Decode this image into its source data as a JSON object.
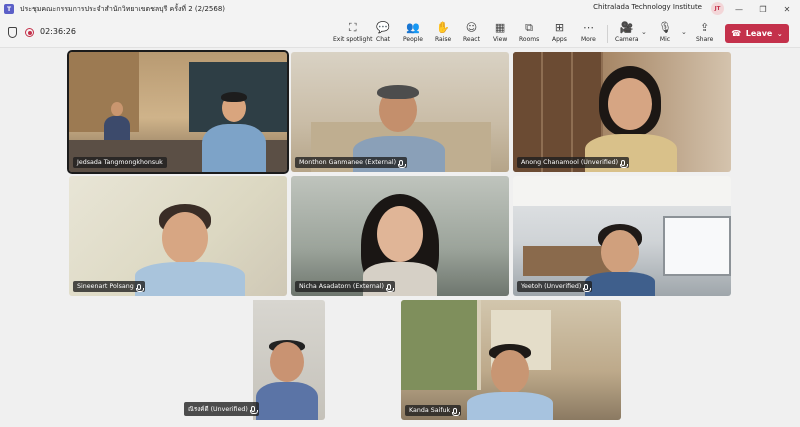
{
  "window": {
    "title": "ประชุมคณะกรรมการประจำสำนักวิทยาเขตชลบุรี ครั้งที่ 2 (2/2568)",
    "organization": "Chitralada Technology Institute",
    "user_initials": "JT",
    "controls": [
      "—",
      "❐",
      "✕"
    ]
  },
  "meeting": {
    "elapsed": "02:36:26"
  },
  "toolbar": {
    "buttons": [
      {
        "label": "Exit spotlight",
        "icon": "exit-spotlight-icon"
      },
      {
        "label": "Chat",
        "icon": "chat-icon"
      },
      {
        "label": "People",
        "icon": "people-icon"
      },
      {
        "label": "Raise",
        "icon": "raise-hand-icon"
      },
      {
        "label": "React",
        "icon": "react-icon"
      },
      {
        "label": "View",
        "icon": "view-icon"
      },
      {
        "label": "Rooms",
        "icon": "rooms-icon"
      },
      {
        "label": "Apps",
        "icon": "apps-icon"
      },
      {
        "label": "More",
        "icon": "more-icon"
      },
      {
        "label": "Camera",
        "icon": "camera-icon"
      },
      {
        "label": "Mic",
        "icon": "mic-icon"
      },
      {
        "label": "Share",
        "icon": "share-icon"
      }
    ],
    "leave_label": "Leave",
    "leave_color": "#c4314b"
  },
  "participants": [
    {
      "name": "Jedsada Tangmongkhonsuk"
    },
    {
      "name": "Monthon Ganmanee (External)"
    },
    {
      "name": "Anong Chanamool (Unverified)"
    },
    {
      "name": "Sineenart Polsang"
    },
    {
      "name": "Nicha Asadatorn (External)"
    },
    {
      "name": "Yeetoh (Unverified)"
    },
    {
      "name": "ณิรงค์ดี (Unverified)"
    },
    {
      "name": "Kanda Saifuk"
    }
  ]
}
